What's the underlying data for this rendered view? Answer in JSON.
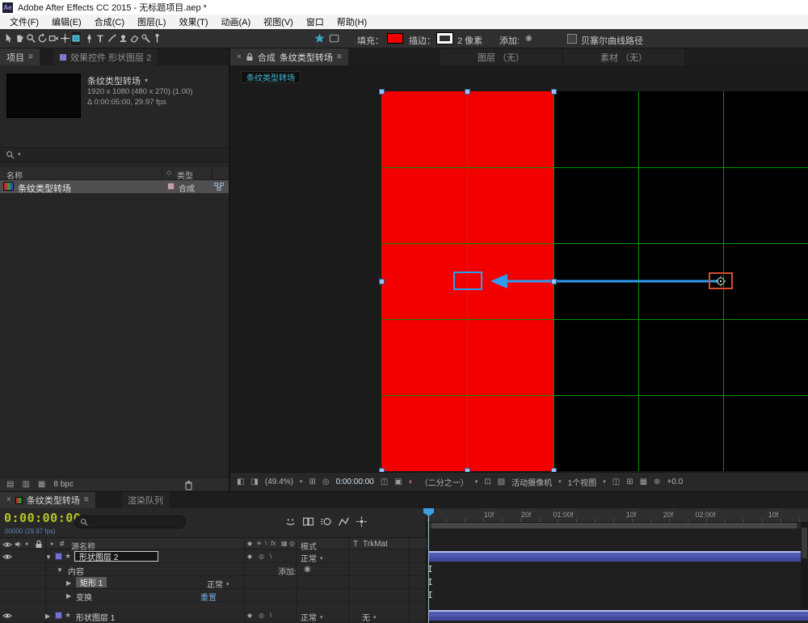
{
  "titlebar": {
    "app_icon": "Ae",
    "title": "Adobe After Effects CC 2015 - 无标题项目.aep *"
  },
  "menubar": {
    "items": [
      "文件(F)",
      "编辑(E)",
      "合成(C)",
      "图层(L)",
      "效果(T)",
      "动画(A)",
      "视图(V)",
      "窗口",
      "帮助(H)"
    ]
  },
  "toolbar": {
    "fill_label": "填充：",
    "fill_color": "#f20000",
    "stroke_label": "描边：",
    "stroke_color": "#ffffff",
    "stroke_width": "2 像素",
    "add_label": "添加:",
    "bezier_path_label": "贝塞尔曲线路径"
  },
  "project_panel": {
    "tab_project": "项目",
    "tab_effect_controls": "效果控件 形状图层 2",
    "preview": {
      "name": "条纹类型转场",
      "line1": "1920 x 1080 (480 x 270) (1.00)",
      "line2": "Δ 0:00:05:00, 29.97 fps"
    },
    "columns": {
      "name": "名称",
      "type": "类型"
    },
    "row": {
      "name": "条纹类型转场",
      "type": "合成"
    },
    "footer": {
      "bpc": "8 bpc"
    }
  },
  "viewer_panel": {
    "tabs": {
      "comp_label": "合成",
      "comp_name": "条纹类型转场",
      "layer": "图层 （无）",
      "footage": "素材 （无）"
    },
    "breadcrumb": "条纹类型转场",
    "status": {
      "zoom": "(49.4%)",
      "timecode": "0:00:00:00",
      "resolution": "（二分之一）",
      "camera": "活动摄像机",
      "views": "1个视图",
      "exposure": "+0.0"
    }
  },
  "timeline_panel": {
    "tabs": {
      "comp": "条纹类型转场",
      "render_queue": "渲染队列"
    },
    "timecode": "0:00:00:00",
    "frame_info": "00000 (29.97 fps)",
    "columns": {
      "hash": "#",
      "source_name": "源名称",
      "mode": "模式",
      "t": "T",
      "trkmat": "TrkMat"
    },
    "ruler_ticks": [
      "10f",
      "20f",
      "01:00f",
      "10f",
      "20f",
      "02:00f",
      "10f"
    ],
    "rows": {
      "layer2": {
        "name": "形状图层 2",
        "mode": "正常"
      },
      "contents": {
        "label": "内容",
        "add_label": "添加:"
      },
      "rect1": {
        "name": "矩形 1",
        "mode": "正常"
      },
      "transform": {
        "label": "变换",
        "reset": "重置"
      },
      "layer1": {
        "name": "形状图层 1",
        "mode": "正常",
        "trkmat": "无"
      }
    }
  },
  "icons": {
    "menu": "≡",
    "close": "×",
    "caret": "▾",
    "expand": "▼",
    "collapse": "▶",
    "solo": "●",
    "dot": "●",
    "star": "★",
    "add_circle": "◉",
    "monitor_a": "◧",
    "monitor_b": "◨",
    "grid": "⊞",
    "mask": "◎",
    "snapshot": "◫",
    "snapshot_show": "▣",
    "channels": "◐",
    "roi": "⊡",
    "transparency": "▨",
    "layout": "◫",
    "pixel_aspect": "⊞",
    "fast_preview": "▦",
    "exposure": "⊕",
    "diamond": "◇",
    "footer_a": "▤",
    "footer_b": "▥",
    "footer_c": "▦",
    "sw1": "◆",
    "sw2": "☀",
    "sw3": "\\",
    "sw_fx": "fx",
    "sw4": "▦",
    "sw5": "◎",
    "sw6": "◐"
  }
}
